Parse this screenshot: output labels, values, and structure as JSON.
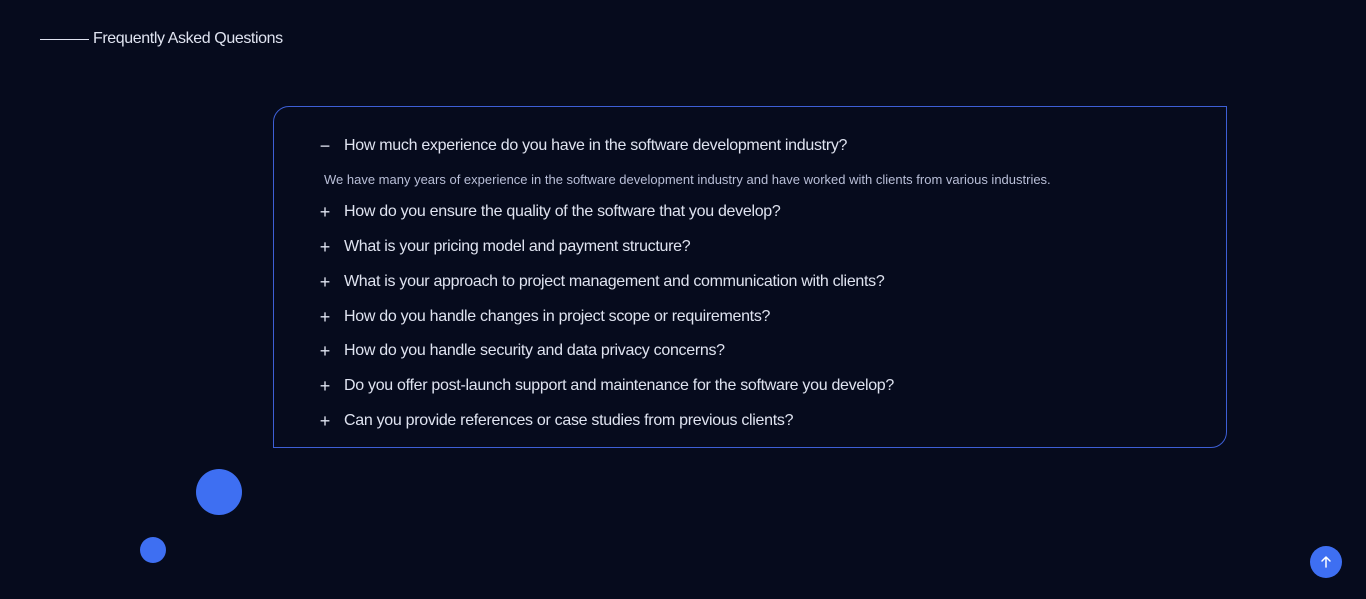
{
  "header": {
    "title": "Frequently Asked Questions"
  },
  "faq": {
    "items": [
      {
        "question": "How much experience do you have in the software development industry?",
        "answer": "We have many years of experience in the software development industry and have worked with clients from various industries.",
        "toggle": "−",
        "expanded": true
      },
      {
        "question": "How do you ensure the quality of the software that you develop?",
        "toggle": "+",
        "expanded": false
      },
      {
        "question": "What is your pricing model and payment structure?",
        "toggle": "+",
        "expanded": false
      },
      {
        "question": "What is your approach to project management and communication with clients?",
        "toggle": "+",
        "expanded": false
      },
      {
        "question": "How do you handle changes in project scope or requirements?",
        "toggle": "+",
        "expanded": false
      },
      {
        "question": "How do you handle security and data privacy concerns?",
        "toggle": "+",
        "expanded": false
      },
      {
        "question": "Do you offer post-launch support and maintenance for the software you develop?",
        "toggle": "+",
        "expanded": false
      },
      {
        "question": "Can you provide references or case studies from previous clients?",
        "toggle": "+",
        "expanded": false
      }
    ]
  },
  "icons": {
    "scroll_top": "arrow-up-icon"
  },
  "colors": {
    "background": "#060b1d",
    "accent": "#3e6ff2",
    "border": "#3d5fd6",
    "text": "#dfe3f0"
  }
}
